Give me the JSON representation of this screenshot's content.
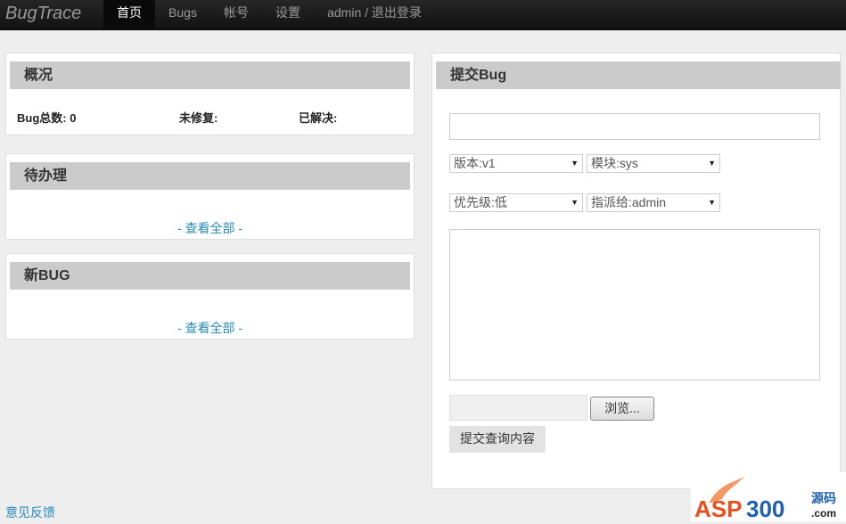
{
  "nav": {
    "brand": "BugTrace",
    "items": [
      {
        "label": "首页"
      },
      {
        "label": "Bugs"
      },
      {
        "label": "帐号"
      },
      {
        "label": "设置"
      },
      {
        "label": "admin / 退出登录"
      }
    ]
  },
  "overview": {
    "title": "概况",
    "total": "Bug总数: 0",
    "unfixed": "未修复:",
    "resolved": "已解决:"
  },
  "todo": {
    "title": "待办理",
    "view_all": "- 查看全部 -"
  },
  "newbug": {
    "title": "新BUG",
    "view_all": "- 查看全部 -"
  },
  "submit": {
    "title": "提交Bug",
    "title_value": "",
    "version": "版本:v1",
    "module": "模块:sys",
    "priority": "优先级:低",
    "assignee": "指派给:admin",
    "description": "",
    "browse": "浏览...",
    "submit_label": "提交查询内容"
  },
  "footer": {
    "feedback": "意见反馈"
  },
  "watermark": {
    "logo": "ASP300 源码 .com"
  }
}
